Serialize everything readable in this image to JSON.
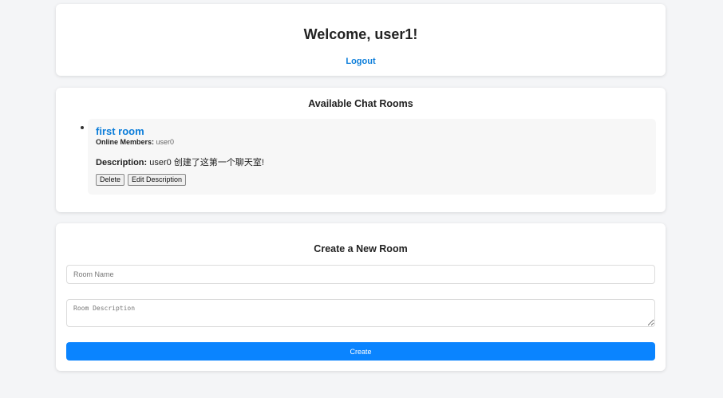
{
  "header": {
    "welcome": "Welcome, user1!",
    "logout_label": "Logout"
  },
  "rooms": {
    "title": "Available Chat Rooms",
    "items": [
      {
        "name": "first room",
        "online_label": "Online Members:",
        "online_members": "user0",
        "description_label": "Description:",
        "description": "user0 创建了这第一个聊天室!",
        "delete_label": "Delete",
        "edit_label": "Edit Description"
      }
    ]
  },
  "create": {
    "title": "Create a New Room",
    "name_placeholder": "Room Name",
    "description_placeholder": "Room Description",
    "button_label": "Create"
  },
  "colors": {
    "accent": "#0a84ff",
    "link": "#0b7dda",
    "background": "#f4f5f7",
    "card": "#ffffff"
  }
}
